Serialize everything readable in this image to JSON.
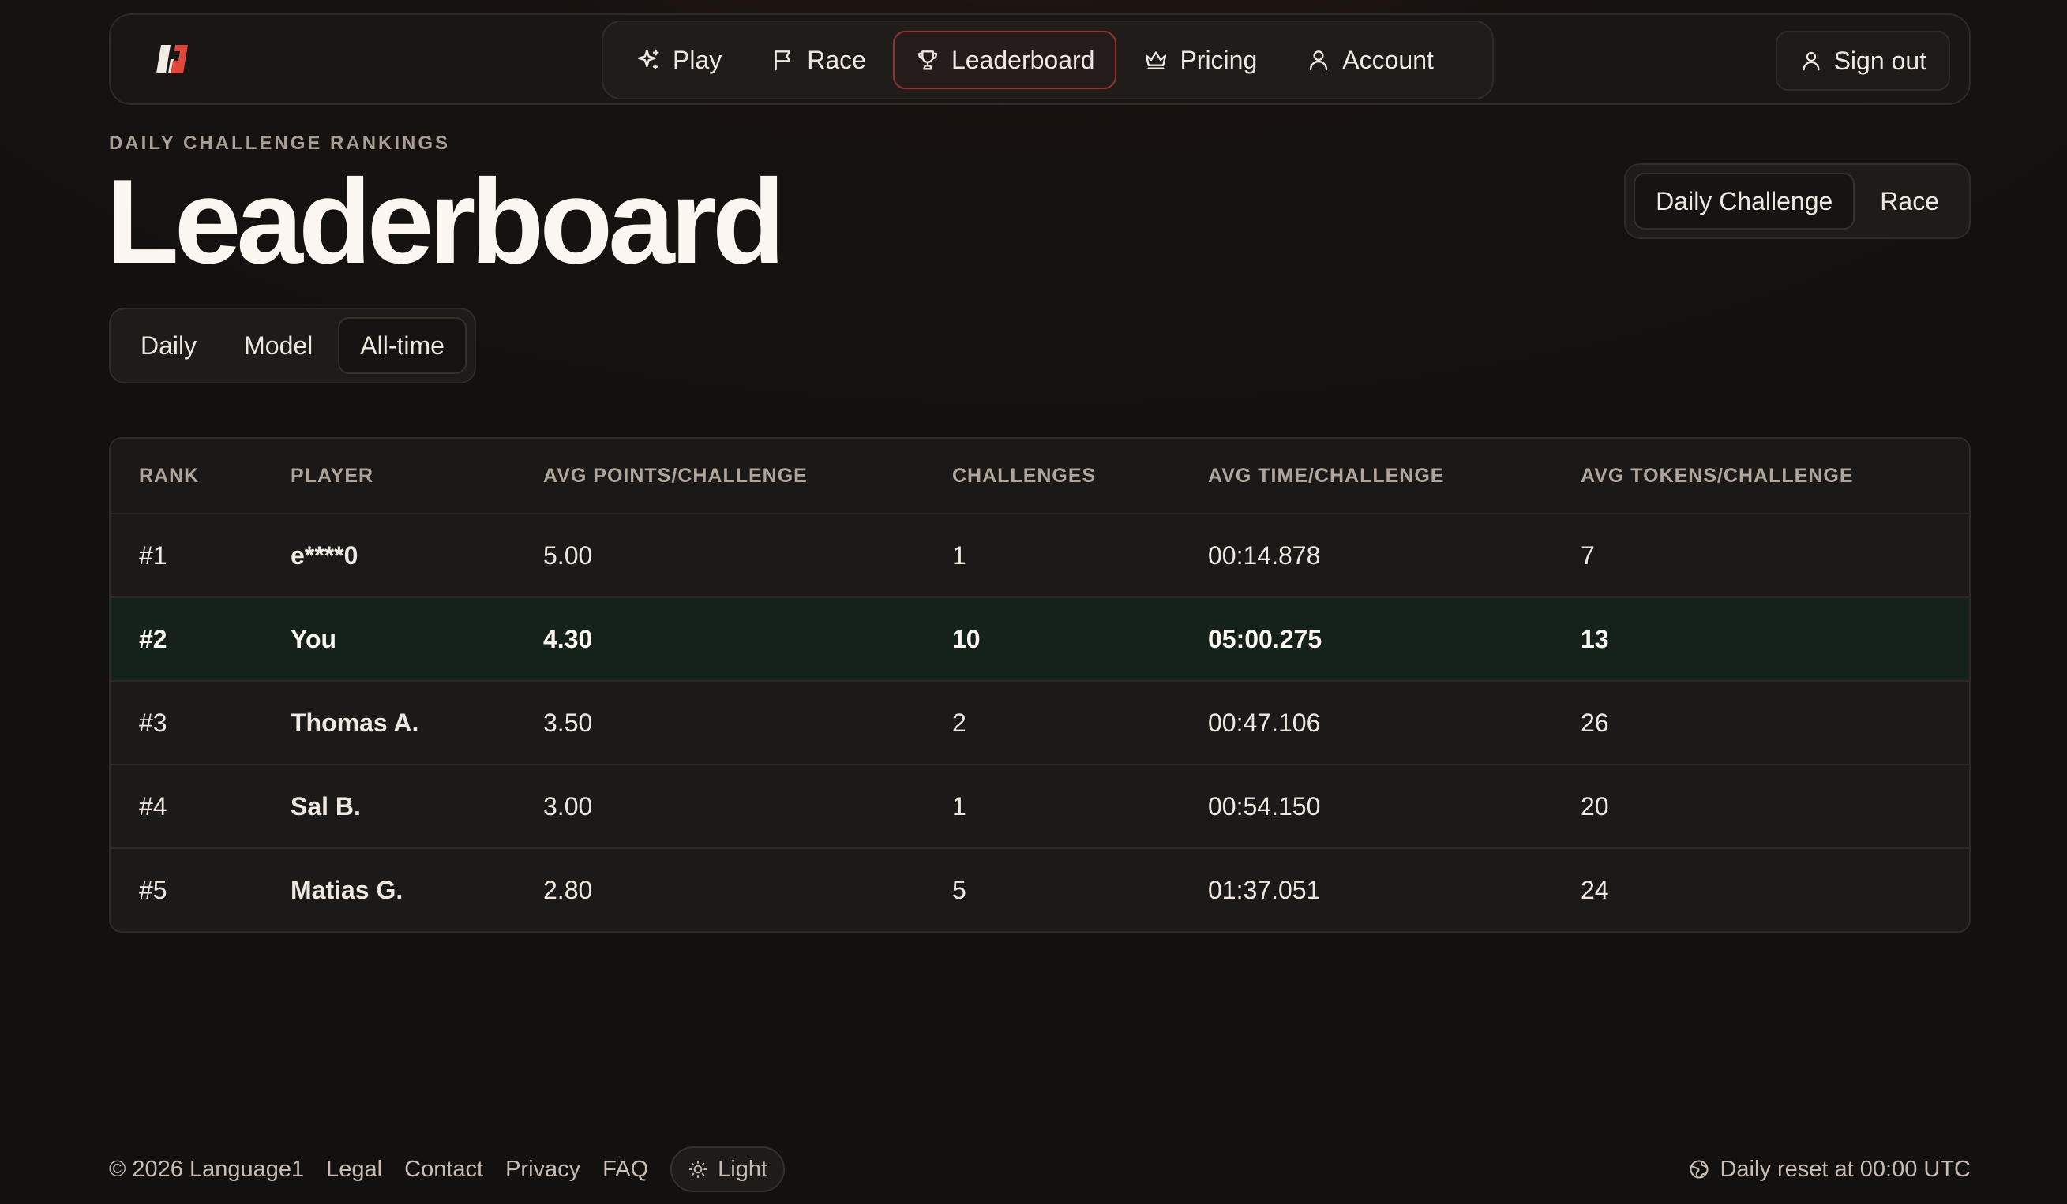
{
  "nav": {
    "items": [
      {
        "label": "Play",
        "icon": "sparkle-icon"
      },
      {
        "label": "Race",
        "icon": "flag-icon"
      },
      {
        "label": "Leaderboard",
        "icon": "trophy-icon",
        "active": true
      },
      {
        "label": "Pricing",
        "icon": "crown-icon"
      },
      {
        "label": "Account",
        "icon": "user-icon"
      }
    ],
    "sign_out": "Sign out"
  },
  "header": {
    "eyebrow": "DAILY CHALLENGE RANKINGS",
    "title": "Leaderboard",
    "mode_tabs": [
      "Daily Challenge",
      "Race"
    ],
    "mode_active": "Daily Challenge",
    "period_tabs": [
      "Daily",
      "Model",
      "All-time"
    ],
    "period_active": "All-time"
  },
  "table": {
    "columns": [
      "RANK",
      "PLAYER",
      "AVG POINTS/CHALLENGE",
      "CHALLENGES",
      "AVG TIME/CHALLENGE",
      "AVG TOKENS/CHALLENGE"
    ],
    "rows": [
      {
        "rank": "#1",
        "player": "e****0",
        "points": "5.00",
        "challenges": "1",
        "time": "00:14.878",
        "tokens": "7"
      },
      {
        "rank": "#2",
        "player": "You",
        "points": "4.30",
        "challenges": "10",
        "time": "05:00.275",
        "tokens": "13",
        "highlight": true
      },
      {
        "rank": "#3",
        "player": "Thomas A.",
        "points": "3.50",
        "challenges": "2",
        "time": "00:47.106",
        "tokens": "26"
      },
      {
        "rank": "#4",
        "player": "Sal B.",
        "points": "3.00",
        "challenges": "1",
        "time": "00:54.150",
        "tokens": "20"
      },
      {
        "rank": "#5",
        "player": "Matias G.",
        "points": "2.80",
        "challenges": "5",
        "time": "01:37.051",
        "tokens": "24"
      }
    ]
  },
  "footer": {
    "copyright": "© 2026 Language1",
    "links": [
      "Legal",
      "Contact",
      "Privacy",
      "FAQ"
    ],
    "theme_toggle": "Light",
    "reset": "Daily reset at 00:00 UTC"
  },
  "colors": {
    "background": "#131110",
    "accent_border": "#8a3530",
    "highlight_row": "#152219",
    "logo_red": "#e2453b"
  }
}
